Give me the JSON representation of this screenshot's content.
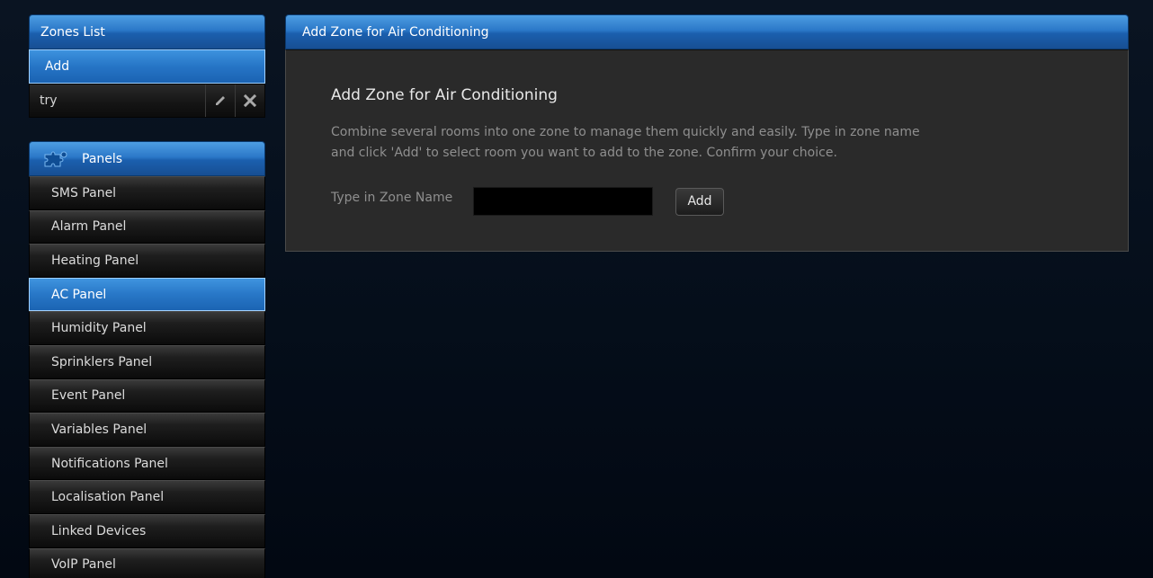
{
  "zones": {
    "header": "Zones List",
    "add_label": "Add",
    "items": [
      {
        "name": "try"
      }
    ]
  },
  "panels": {
    "header": "Panels",
    "items": [
      {
        "label": "SMS Panel"
      },
      {
        "label": "Alarm Panel"
      },
      {
        "label": "Heating Panel"
      },
      {
        "label": "AC Panel",
        "active": true
      },
      {
        "label": "Humidity Panel"
      },
      {
        "label": "Sprinklers Panel"
      },
      {
        "label": "Event Panel"
      },
      {
        "label": "Variables Panel"
      },
      {
        "label": "Notifications Panel"
      },
      {
        "label": "Localisation Panel"
      },
      {
        "label": "Linked Devices"
      },
      {
        "label": "VoIP Panel"
      }
    ]
  },
  "main": {
    "header": "Add Zone for Air Conditioning",
    "title": "Add Zone for Air Conditioning",
    "description": "Combine several rooms into one zone to manage them quickly and easily. Type in zone name and click 'Add' to select room you want to add to the zone. Confirm your choice.",
    "form": {
      "label": "Type in Zone Name",
      "value": "",
      "button_label": "Add"
    }
  },
  "colors": {
    "accent_blue": "#2b78c8",
    "active_border": "#9fd0ff"
  },
  "icons": {
    "panels_header": "puzzle-icon",
    "zone_edit": "pencil-icon",
    "zone_delete": "close-icon"
  }
}
